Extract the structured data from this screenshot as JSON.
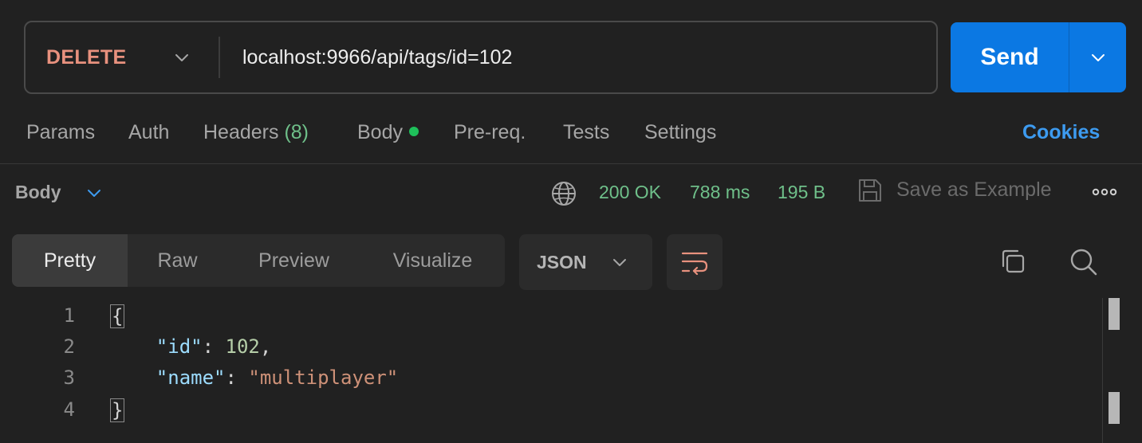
{
  "request": {
    "method": "DELETE",
    "url": "localhost:9966/api/tags/id=102",
    "send_label": "Send"
  },
  "request_tabs": [
    {
      "label": "Params"
    },
    {
      "label": "Auth"
    },
    {
      "label": "Headers",
      "count": "(8)"
    },
    {
      "label": "Body",
      "indicator": "dot"
    },
    {
      "label": "Pre-req."
    },
    {
      "label": "Tests"
    },
    {
      "label": "Settings"
    }
  ],
  "cookies_label": "Cookies",
  "response": {
    "section_label": "Body",
    "status": "200 OK",
    "time": "788 ms",
    "size": "195 B",
    "save_label": "Save as Example"
  },
  "view_tabs": [
    {
      "label": "Pretty",
      "active": true
    },
    {
      "label": "Raw"
    },
    {
      "label": "Preview"
    },
    {
      "label": "Visualize"
    }
  ],
  "format": "JSON",
  "code_lines": [
    {
      "num": "1",
      "open_brace": "{"
    },
    {
      "num": "2",
      "key": "\"id\"",
      "value": "102",
      "value_type": "number",
      "trailing": ","
    },
    {
      "num": "3",
      "key": "\"name\"",
      "value": "\"multiplayer\"",
      "value_type": "string",
      "trailing": ""
    },
    {
      "num": "4",
      "close_brace": "}"
    }
  ],
  "icons": {
    "method_dropdown": "chevron-down-icon",
    "send_dropdown": "chevron-down-icon",
    "response_dropdown": "chevron-down-icon",
    "network": "globe-icon",
    "save": "save-icon",
    "more": "more-horizontal-icon",
    "format_dropdown": "chevron-down-icon",
    "wrap": "wrap-lines-icon",
    "copy": "copy-icon",
    "search": "search-icon"
  },
  "colors": {
    "background": "#212121",
    "method": "#e8917e",
    "send_button": "#0b78e3",
    "cookies_link": "#3d9bf0",
    "status_ok": "#6fc08a",
    "body_indicator": "#1ec05a",
    "wrap_icon": "#e8917e",
    "json_key": "#9cdcfe",
    "json_number": "#b5cea8",
    "json_string": "#ce9178"
  }
}
